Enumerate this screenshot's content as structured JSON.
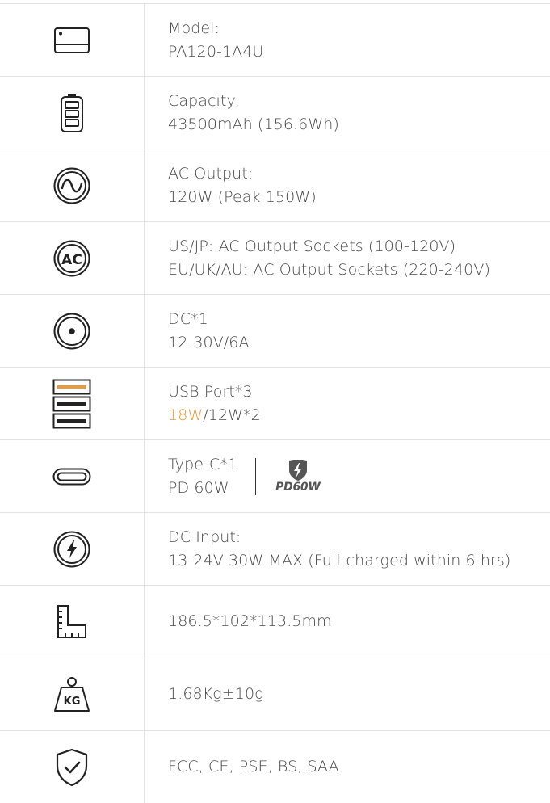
{
  "rows": [
    {
      "id": "model",
      "lines": [
        "Model:",
        "PA120-1A4U"
      ],
      "icon": "power-station-icon"
    },
    {
      "id": "capacity",
      "lines": [
        "Capacity:",
        "43500mAh (156.6Wh)"
      ],
      "icon": "battery-icon"
    },
    {
      "id": "ac-output",
      "lines": [
        "AC Output:",
        "120W (Peak 150W)"
      ],
      "icon": "ac-wave-icon"
    },
    {
      "id": "ac-sockets",
      "lines": [
        "US/JP: AC Output Sockets (100-120V)",
        "EU/UK/AU: AC Output Sockets (220-240V)"
      ],
      "icon": "ac-socket-icon",
      "icon_text": "AC"
    },
    {
      "id": "dc",
      "lines": [
        "DC*1",
        "12-30V/6A"
      ],
      "icon": "dc-port-icon"
    },
    {
      "id": "usb",
      "lines": [
        "USB Port*3"
      ],
      "line2_accent": "18W",
      "line2_rest": "/12W*2",
      "icon": "usb-ports-icon"
    },
    {
      "id": "type-c",
      "lines": [
        "Type-C*1",
        "PD 60W"
      ],
      "badge_text": "PD60W",
      "icon": "type-c-port-icon"
    },
    {
      "id": "dc-input",
      "lines": [
        "DC Input:",
        "13-24V 30W MAX (Full-charged within 6 hrs)"
      ],
      "icon": "dc-input-icon"
    },
    {
      "id": "dimensions",
      "lines": [
        "186.5*102*113.5mm"
      ],
      "icon": "dimensions-icon"
    },
    {
      "id": "weight",
      "lines": [
        "1.68Kg±10g"
      ],
      "icon": "weight-icon",
      "icon_text": "KG"
    },
    {
      "id": "certs",
      "lines": [
        "FCC, CE, PSE, BS, SAA"
      ],
      "icon": "shield-check-icon"
    }
  ],
  "colors": {
    "accent": "#e89a3c",
    "text": "#4a4a4a",
    "border": "#e3e3e3",
    "icon": "#222222"
  }
}
